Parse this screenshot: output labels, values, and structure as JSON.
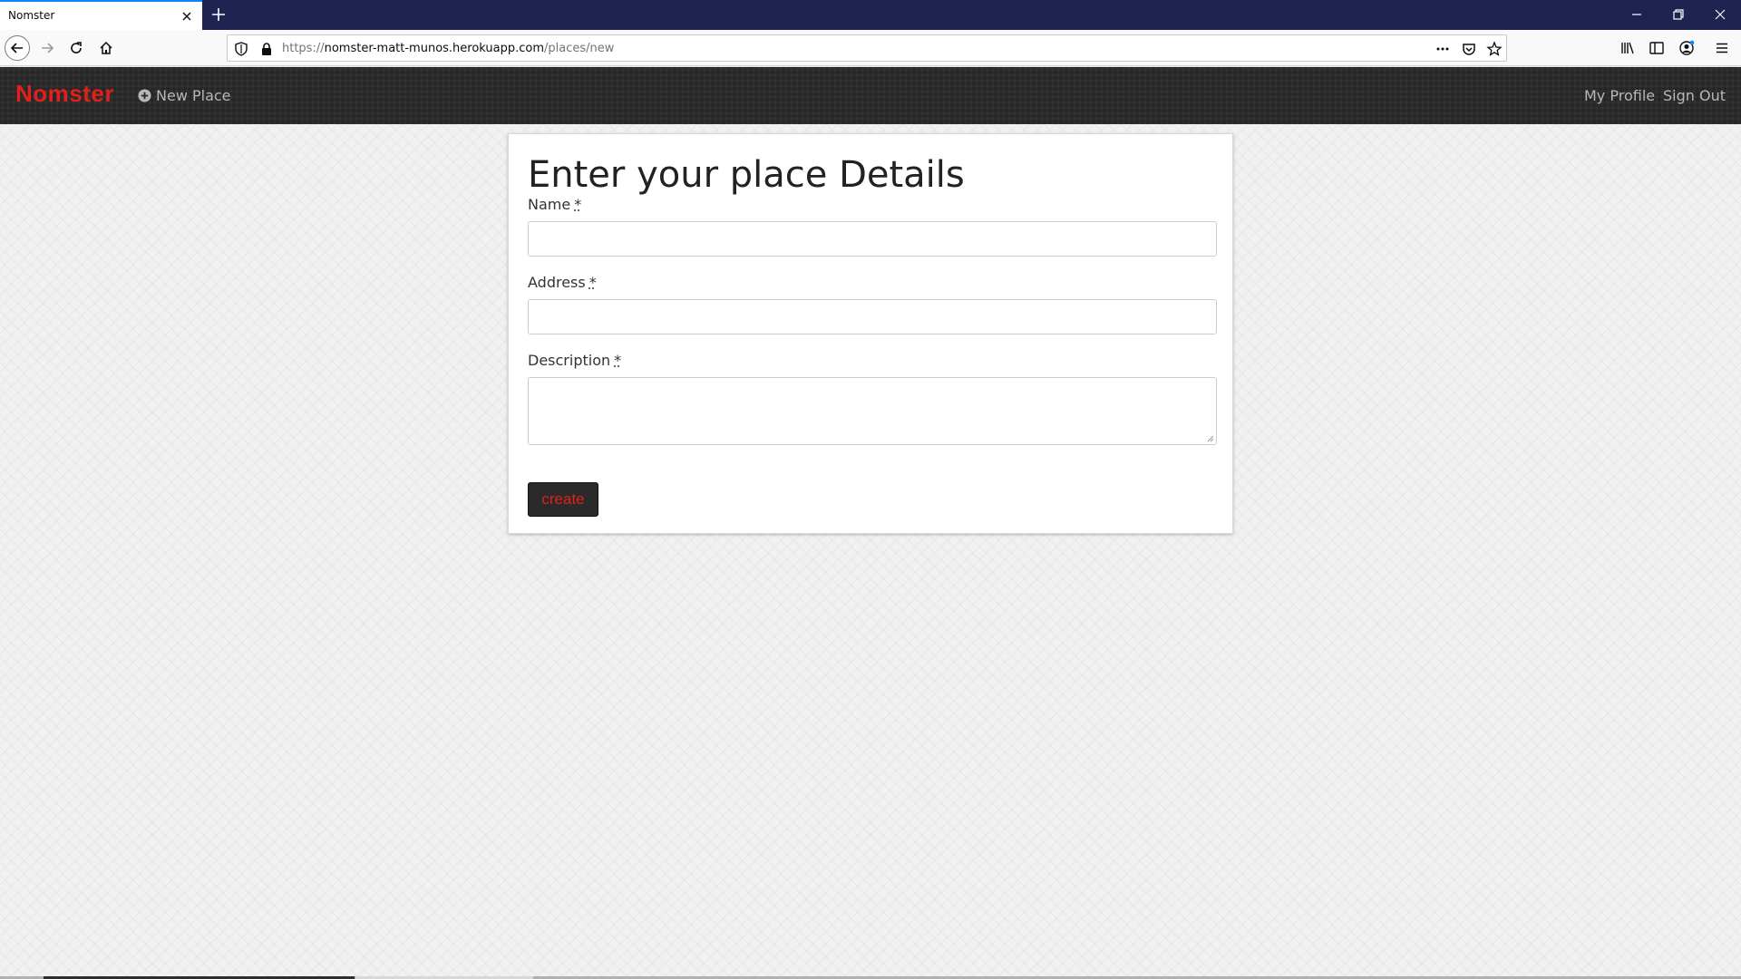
{
  "browser": {
    "tab_title": "Nomster",
    "url_scheme": "https://",
    "url_host": "nomster-matt-munos.herokuapp.com",
    "url_path": "/places/new"
  },
  "site": {
    "brand": "Nomster",
    "nav_new_place": "New Place",
    "nav_my_profile": "My Profile",
    "nav_sign_out": "Sign Out",
    "brand_color": "#e0201b"
  },
  "form": {
    "heading": "Enter your place Details",
    "name_label": "Name",
    "address_label": "Address",
    "description_label": "Description",
    "required_marker": "*",
    "name_value": "",
    "address_value": "",
    "description_value": "",
    "submit_label": "create"
  }
}
